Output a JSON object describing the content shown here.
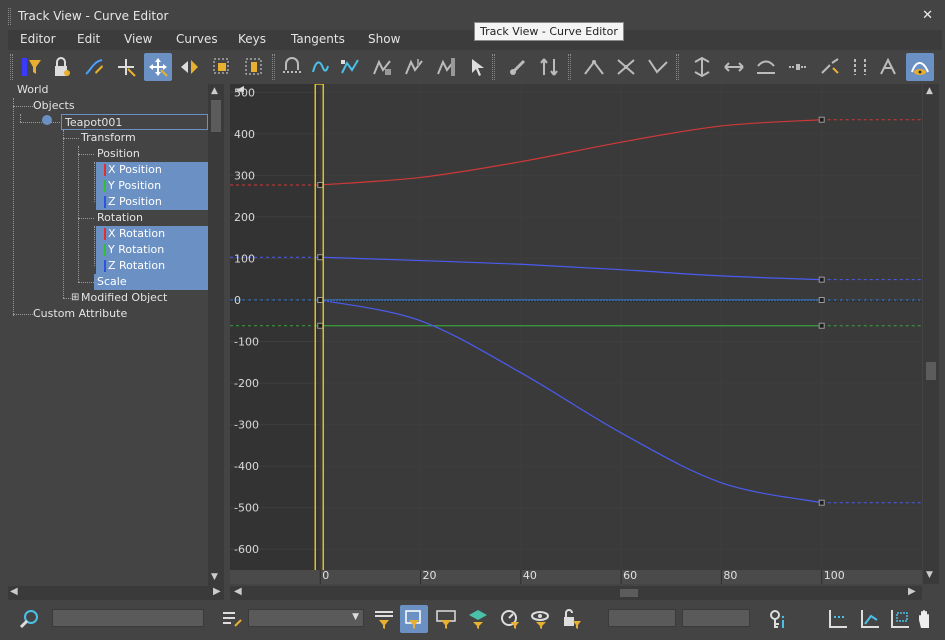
{
  "window": {
    "title": "Track View - Curve Editor",
    "close_glyph": "✕"
  },
  "tooltip": {
    "text": "Track View - Curve Editor"
  },
  "menu": [
    "Editor",
    "Edit",
    "View",
    "Curves",
    "Keys",
    "Tangents",
    "Show"
  ],
  "toolbar": {
    "buttons": [
      {
        "name": "filters-icon"
      },
      {
        "name": "lock-selection-icon"
      },
      {
        "name": "draw-curves-icon"
      },
      {
        "name": "add-keys-icon"
      },
      {
        "name": "move-keys-icon",
        "active": true
      },
      {
        "name": "slide-keys-icon"
      },
      {
        "name": "scale-keys-icon"
      },
      {
        "name": "scale-values-icon"
      },
      {
        "name": "snap-frames-icon"
      },
      {
        "name": "parameter-curve-out-of-range-icon"
      },
      {
        "name": "region-tool-icon"
      },
      {
        "name": "retimer-icon"
      },
      {
        "name": "retimer-global-icon"
      },
      {
        "name": "soft-selection-icon"
      },
      {
        "name": "select-cursor-icon"
      },
      {
        "name": "reduce-keys-icon"
      },
      {
        "name": "key-filter-icon"
      },
      {
        "name": "tangent-auto-icon"
      },
      {
        "name": "tangent-spline-icon"
      },
      {
        "name": "tangent-fast-icon"
      },
      {
        "name": "move-time-icon"
      },
      {
        "name": "scale-time-icon"
      },
      {
        "name": "flatten-icon"
      },
      {
        "name": "insert-time-icon"
      },
      {
        "name": "break-tangents-icon"
      },
      {
        "name": "unify-tangents-icon"
      },
      {
        "name": "show-tangents-icon"
      },
      {
        "name": "show-curves-icon",
        "active": true
      }
    ]
  },
  "tree": {
    "world": "World",
    "objects": "Objects",
    "teapot": "Teapot001",
    "transform": "Transform",
    "position": "Position",
    "x_position": "X Position",
    "y_position": "Y Position",
    "z_position": "Z Position",
    "rotation": "Rotation",
    "x_rotation": "X Rotation",
    "y_rotation": "Y Rotation",
    "z_rotation": "Z Rotation",
    "scale": "Scale",
    "modified_object": "Modified Object",
    "custom_attribute": "Custom Attribute",
    "expand_glyph": "⊞"
  },
  "colors": {
    "x_axis": "#e03030",
    "y_axis": "#30c030",
    "z_axis": "#3050e0",
    "selection": "#6b91c4",
    "time_slider": "#e0c020"
  },
  "chart_data": {
    "type": "line",
    "y_ticks": [
      500,
      400,
      300,
      200,
      100,
      0,
      -100,
      -200,
      -300,
      -400,
      -500,
      -600
    ],
    "x_ticks": [
      0,
      20,
      40,
      60,
      80,
      100
    ],
    "ylim": [
      -650,
      520
    ],
    "xlim": [
      -18,
      120
    ],
    "current_frame": 0,
    "keys_range": [
      0,
      100
    ],
    "series": [
      {
        "color": "#d03838",
        "x": [
          0,
          20,
          40,
          60,
          80,
          100
        ],
        "y": [
          277,
          295,
          333,
          380,
          419,
          434
        ]
      },
      {
        "color": "#4a5cf0",
        "x": [
          0,
          20,
          40,
          60,
          80,
          100
        ],
        "y": [
          103,
          95,
          86,
          73,
          58,
          49
        ]
      },
      {
        "color": "#3aa03a",
        "x": [
          0,
          100
        ],
        "y": [
          -62,
          -62
        ]
      },
      {
        "color": "#4a5cf0",
        "x": [
          0,
          20,
          40,
          60,
          80,
          100
        ],
        "y": [
          0,
          -50,
          -175,
          -320,
          -440,
          -488
        ]
      },
      {
        "color": "#3a7cd0",
        "x": [
          0,
          100
        ],
        "y": [
          0,
          0
        ]
      }
    ]
  }
}
